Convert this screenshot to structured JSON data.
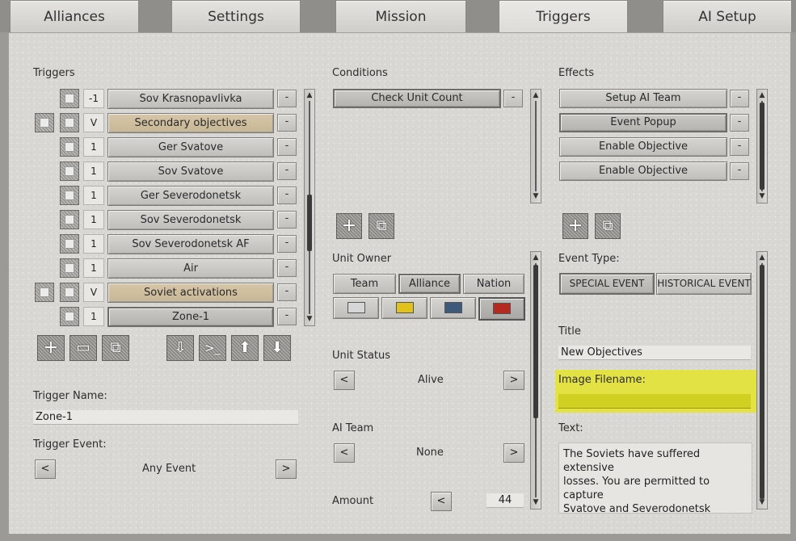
{
  "tabs": [
    {
      "label": "Alliances",
      "active": false
    },
    {
      "label": "Settings",
      "active": false
    },
    {
      "label": "Mission",
      "active": false
    },
    {
      "label": "Triggers",
      "active": true
    },
    {
      "label": "AI Setup",
      "active": false
    }
  ],
  "triggers": {
    "heading": "Triggers",
    "items": [
      {
        "num": "-1",
        "label": "Sov Krasnopavlivka",
        "group": false
      },
      {
        "num": "V",
        "label": "Secondary objectives",
        "group": true
      },
      {
        "num": "1",
        "label": "Ger Svatove",
        "group": false
      },
      {
        "num": "1",
        "label": "Sov Svatove",
        "group": false
      },
      {
        "num": "1",
        "label": "Ger Severodonetsk",
        "group": false
      },
      {
        "num": "1",
        "label": "Sov Severodonetsk",
        "group": false
      },
      {
        "num": "1",
        "label": "Sov Severodonetsk AF",
        "group": false
      },
      {
        "num": "1",
        "label": "Air",
        "group": false
      },
      {
        "num": "V",
        "label": "Soviet activations",
        "group": true
      },
      {
        "num": "1",
        "label": "Zone-1",
        "group": false,
        "selected": true
      }
    ],
    "remove_label": "-",
    "name_label": "Trigger Name:",
    "name_value": "Zone-1",
    "event_label": "Trigger Event:",
    "event_value": "Any Event",
    "prev": "<",
    "next": ">"
  },
  "conditions": {
    "heading": "Conditions",
    "items": [
      {
        "label": "Check Unit Count"
      }
    ],
    "remove_label": "-",
    "unit_owner_label": "Unit Owner",
    "owner_tabs": [
      "Team",
      "Alliance",
      "Nation"
    ],
    "owner_selected": "Alliance",
    "colors": [
      "#d6d6d6",
      "#e0c21a",
      "#3d5a7a",
      "#b52a1e"
    ],
    "unit_status_label": "Unit Status",
    "unit_status_value": "Alive",
    "ai_team_label": "AI Team",
    "ai_team_value": "None",
    "amount_label": "Amount",
    "amount_value": "44",
    "prev": "<",
    "next": ">"
  },
  "effects": {
    "heading": "Effects",
    "items": [
      {
        "label": "Setup AI Team"
      },
      {
        "label": "Event Popup"
      },
      {
        "label": "Enable Objective"
      },
      {
        "label": "Enable Objective"
      }
    ],
    "remove_label": "-",
    "event_type_label": "Event Type:",
    "event_types": [
      "SPECIAL EVENT",
      "HISTORICAL EVENT"
    ],
    "title_label": "Title",
    "title_value": "New Objectives",
    "image_label": "Image Filename:",
    "image_value": "",
    "text_label": "Text:",
    "text_value": "The Soviets have suffered extensive\nlosses. You are permitted to capture\nSvatove and  Severodonetsk"
  },
  "icons": {
    "add": "+",
    "folder": "▭",
    "copy": "⧉",
    "import": "⇩",
    "console": ">_",
    "up": "⬆",
    "down": "⬇"
  }
}
